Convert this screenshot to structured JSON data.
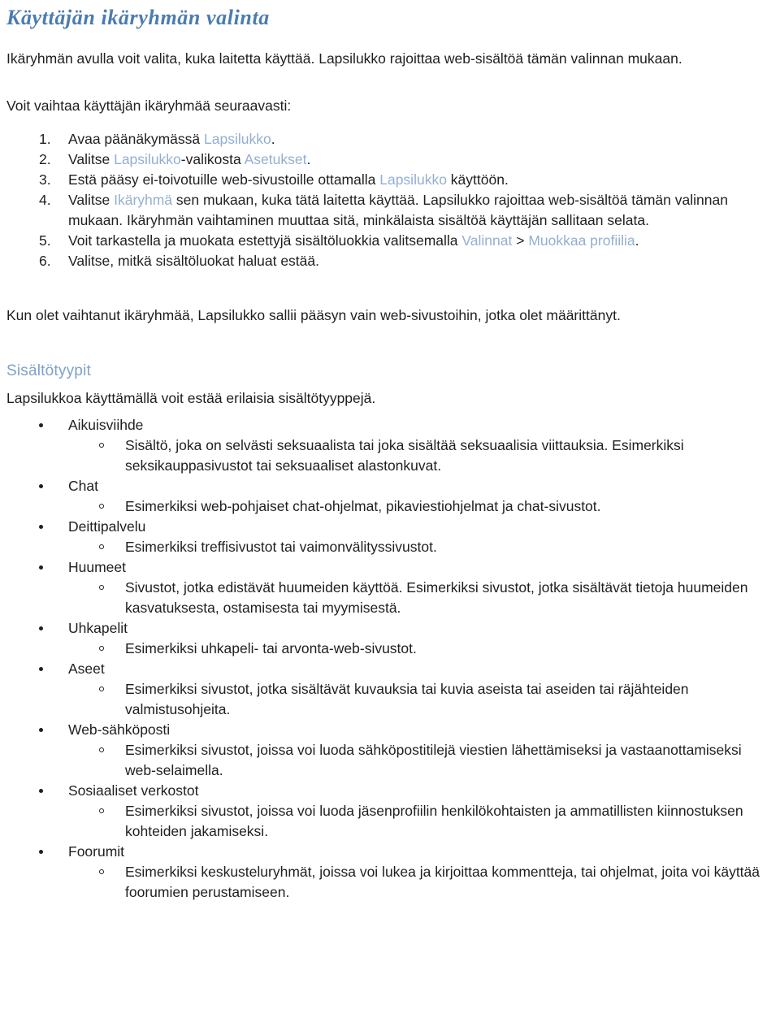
{
  "document": {
    "title": "Käyttäjän ikäryhmän valinta",
    "intro_paragraph": "Ikäryhmän avulla voit valita, kuka laitetta käyttää. Lapsilukko rajoittaa web-sisältöä tämän valinnan mukaan.",
    "howto_lead": "Voit vaihtaa käyttäjän ikäryhmää seuraavasti:",
    "after_list_paragraph": "Kun olet vaihtanut ikäryhmää, Lapsilukko sallii pääsyn vain web-sivustoihin, jotka olet määrittänyt."
  },
  "colors": {
    "title_blue": "#4b7cb0",
    "subhead_blue": "#7da2c8",
    "inline_term_blue": "#93afd0",
    "body_text": "#1f1f1f",
    "page_background": "#ffffff"
  },
  "steps": [
    {
      "number": "1.",
      "parts": [
        {
          "text": "Avaa päänäkymässä ",
          "style": "normal"
        },
        {
          "text": "Lapsilukko",
          "style": "highlight"
        },
        {
          "text": ".",
          "style": "normal"
        }
      ]
    },
    {
      "number": "2.",
      "parts": [
        {
          "text": "Valitse ",
          "style": "normal"
        },
        {
          "text": "Lapsilukko",
          "style": "highlight"
        },
        {
          "text": "-valikosta ",
          "style": "normal"
        },
        {
          "text": "Asetukset",
          "style": "highlight"
        },
        {
          "text": ".",
          "style": "normal"
        }
      ]
    },
    {
      "number": "3.",
      "parts": [
        {
          "text": "Estä pääsy ei-toivotuille web-sivustoille ottamalla ",
          "style": "normal"
        },
        {
          "text": "Lapsilukko",
          "style": "highlight"
        },
        {
          "text": " käyttöön.",
          "style": "normal"
        }
      ]
    },
    {
      "number": "4.",
      "parts": [
        {
          "text": "Valitse ",
          "style": "normal"
        },
        {
          "text": "Ikäryhmä",
          "style": "highlight"
        },
        {
          "text": " sen mukaan, kuka tätä laitetta käyttää. Lapsilukko rajoittaa web-sisältöä tämän valinnan mukaan. Ikäryhmän vaihtaminen muuttaa sitä, minkälaista sisältöä käyttäjän sallitaan selata.",
          "style": "normal"
        }
      ]
    },
    {
      "number": "5.",
      "parts": [
        {
          "text": "Voit tarkastella ja muokata estettyjä sisältöluokkia valitsemalla ",
          "style": "normal"
        },
        {
          "text": "Valinnat",
          "style": "highlight"
        },
        {
          "text": " > ",
          "style": "normal"
        },
        {
          "text": "Muokkaa profiilia",
          "style": "highlight"
        },
        {
          "text": ".",
          "style": "normal"
        }
      ]
    },
    {
      "number": "6.",
      "parts": [
        {
          "text": "Valitse, mitkä sisältöluokat haluat estää.",
          "style": "normal"
        }
      ]
    }
  ],
  "content_types_section": {
    "heading": "Sisältötyypit",
    "intro": "Lapsilukkoa käyttämällä voit estää erilaisia sisältötyyppejä.",
    "items": [
      {
        "label": "Aikuisviihde",
        "details": [
          "Sisältö, joka on selvästi seksuaalista tai joka sisältää seksuaalisia viittauksia. Esimerkiksi seksikauppasivustot tai seksuaaliset alastonkuvat."
        ]
      },
      {
        "label": "Chat",
        "details": [
          "Esimerkiksi web-pohjaiset chat-ohjelmat, pikaviestiohjelmat ja chat-sivustot."
        ]
      },
      {
        "label": "Deittipalvelu",
        "details": [
          "Esimerkiksi treffisivustot tai vaimonvälityssivustot."
        ]
      },
      {
        "label": "Huumeet",
        "details": [
          "Sivustot, jotka edistävät huumeiden käyttöä. Esimerkiksi sivustot, jotka sisältävät tietoja huumeiden kasvatuksesta, ostamisesta tai myymisestä."
        ]
      },
      {
        "label": "Uhkapelit",
        "details": [
          "Esimerkiksi uhkapeli- tai arvonta-web-sivustot."
        ]
      },
      {
        "label": "Aseet",
        "details": [
          "Esimerkiksi sivustot, jotka sisältävät kuvauksia tai kuvia aseista tai aseiden tai räjähteiden valmistusohjeita."
        ]
      },
      {
        "label": "Web-sähköposti",
        "details": [
          "Esimerkiksi sivustot, joissa voi luoda sähköpostitilejä viestien lähettämiseksi ja vastaanottamiseksi web-selaimella."
        ]
      },
      {
        "label": "Sosiaaliset verkostot",
        "details": [
          "Esimerkiksi sivustot, joissa voi luoda jäsenprofiilin henkilökohtaisten ja ammatillisten kiinnostuksen kohteiden jakamiseksi."
        ]
      },
      {
        "label": "Foorumit",
        "details": [
          "Esimerkiksi keskusteluryhmät, joissa voi lukea ja kirjoittaa kommentteja, tai ohjelmat, joita voi käyttää foorumien perustamiseen."
        ]
      }
    ]
  }
}
